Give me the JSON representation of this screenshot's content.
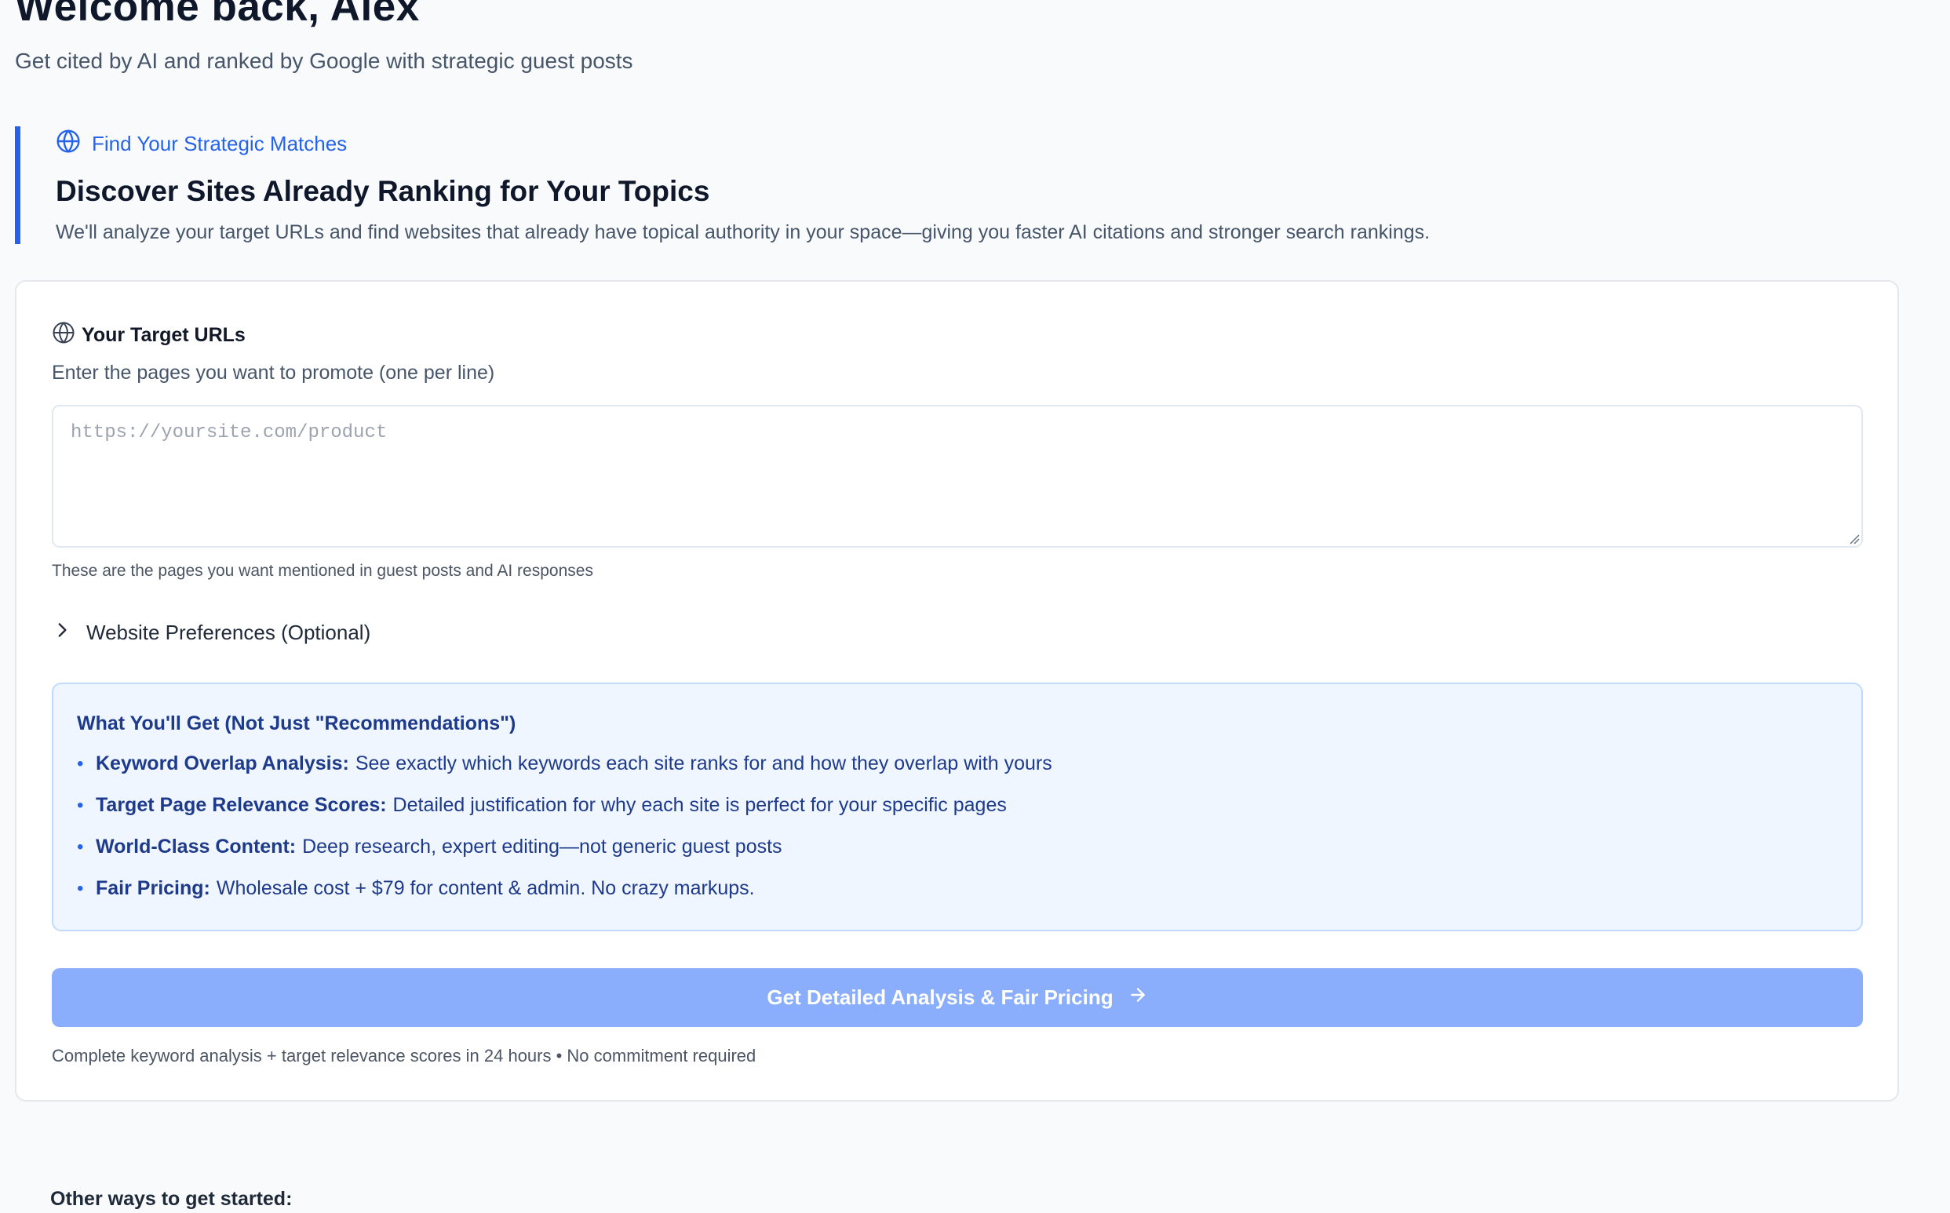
{
  "header": {
    "title": "Welcome back, Alex",
    "subtitle": "Get cited by AI and ranked by Google with strategic guest posts"
  },
  "hero": {
    "kicker_icon": "globe-icon",
    "kicker": "Find Your Strategic Matches",
    "title": "Discover Sites Already Ranking for Your Topics",
    "description": "We'll analyze your target URLs and find websites that already have topical authority in your space—giving you faster AI citations and stronger search rankings."
  },
  "form": {
    "label_icon": "globe-icon",
    "label": "Your Target URLs",
    "help": "Enter the pages you want to promote (one per line)",
    "textarea": {
      "value": "",
      "placeholder": "https://yoursite.com/product"
    },
    "note": "These are the pages you want mentioned in guest posts and AI responses",
    "preferences_toggle": {
      "icon": "chevron-right-icon",
      "label": "Website Preferences (Optional)"
    }
  },
  "benefits": {
    "title": "What You'll Get (Not Just \"Recommendations\")",
    "bullet": "•",
    "items": [
      {
        "term": "Keyword Overlap Analysis:",
        "text": "See exactly which keywords each site ranks for and how they overlap with yours"
      },
      {
        "term": "Target Page Relevance Scores:",
        "text": "Detailed justification for why each site is perfect for your specific pages"
      },
      {
        "term": "World-Class Content:",
        "text": "Deep research, expert editing—not generic guest posts"
      },
      {
        "term": "Fair Pricing:",
        "text": "Wholesale cost + $79 for content & admin. No crazy markups."
      }
    ]
  },
  "cta": {
    "label": "Get Detailed Analysis & Fair Pricing",
    "icon": "arrow-right-icon",
    "note": "Complete keyword analysis + target relevance scores in 24 hours • No commitment required"
  },
  "footer_section": {
    "title": "Other ways to get started:"
  },
  "colors": {
    "accent": "#2563eb",
    "cta_disabled": "#8aaefc",
    "benefits_bg": "#eff6ff",
    "benefits_text": "#1e3a8a",
    "page_bg": "#f8fafc"
  }
}
